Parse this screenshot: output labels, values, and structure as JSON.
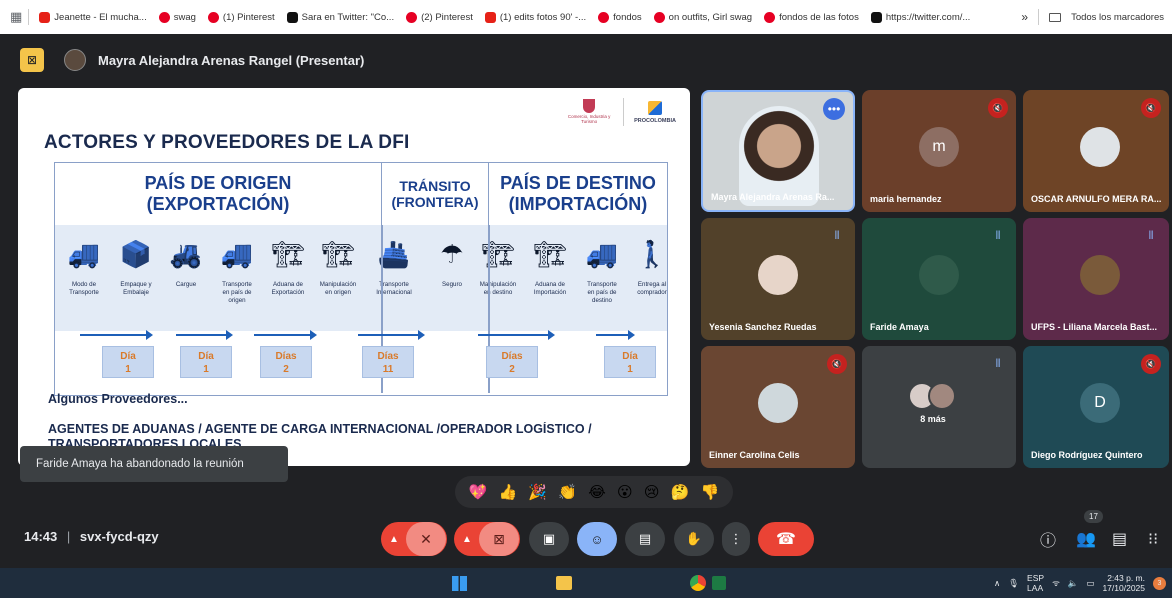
{
  "bookmarks": [
    {
      "label": "Jeanette - El mucha...",
      "icon": "youtube-icon",
      "color": "#e62117"
    },
    {
      "label": "swag",
      "icon": "pinterest-icon",
      "color": "#e60023"
    },
    {
      "label": "(1) Pinterest",
      "icon": "pinterest-icon",
      "color": "#e60023"
    },
    {
      "label": "Sara en Twitter: \"Co...",
      "icon": "x-icon",
      "color": "#111111"
    },
    {
      "label": "(2) Pinterest",
      "icon": "pinterest-icon",
      "color": "#e60023"
    },
    {
      "label": "(1) edits fotos 90' -...",
      "icon": "youtube-icon",
      "color": "#e62117"
    },
    {
      "label": "fondos",
      "icon": "pinterest-icon",
      "color": "#e60023"
    },
    {
      "label": "on outfits, Girl swag",
      "icon": "pinterest-icon",
      "color": "#e60023"
    },
    {
      "label": "fondos de las fotos",
      "icon": "pinterest-icon",
      "color": "#e60023"
    },
    {
      "label": "https://twitter.com/...",
      "icon": "x-icon",
      "color": "#111111"
    }
  ],
  "bookmarks_more": "»",
  "all_bookmarks": "Todos los marcadores",
  "presenter": "Mayra Alejandra Arenas Rangel (Presentar)",
  "slide": {
    "title": "ACTORES Y PROVEEDORES DE LA DFI",
    "logo1": "Comercio, Industria y Turismo",
    "logo2": "PROCOLOMBIA",
    "header_origen": "PAÍS DE ORIGEN\n(EXPORTACIÓN)",
    "header_transito": "TRÁNSITO\n(FRONTERA)",
    "header_destino": "PAÍS DE DESTINO\n(IMPORTACIÓN)",
    "steps": [
      {
        "label": "Modo de\nTransporte",
        "icon": "truck-icon"
      },
      {
        "label": "Empaque y\nEmbalaje",
        "icon": "box-icon"
      },
      {
        "label": "Cargue",
        "icon": "forklift-icon"
      },
      {
        "label": "Transporte\nen país de\norigen",
        "icon": "truck-icon"
      },
      {
        "label": "Aduana de\nExportación",
        "icon": "customs-icon"
      },
      {
        "label": "Manipulación\nen origen",
        "icon": "crane-icon"
      },
      {
        "label": "Transporte\nInternacional",
        "icon": "ship-icon"
      },
      {
        "label": "Seguro",
        "icon": "umbrella-icon"
      },
      {
        "label": "Manipulación\nen destino",
        "icon": "crane-icon"
      },
      {
        "label": "Aduana de\nImportación",
        "icon": "customs-icon"
      },
      {
        "label": "Transporte\nen país de\ndestino",
        "icon": "truck-icon"
      },
      {
        "label": "Entrega al\ncomprador",
        "icon": "person-icon"
      }
    ],
    "days": [
      {
        "label": "Día",
        "num": "1"
      },
      {
        "label": "Día",
        "num": "1"
      },
      {
        "label": "Días",
        "num": "2"
      },
      {
        "label": "Días",
        "num": "11"
      },
      {
        "label": "Días",
        "num": "2"
      },
      {
        "label": "Día",
        "num": "1"
      }
    ],
    "proveedores": "Algunos Proveedores...",
    "agentes": "AGENTES DE ADUANAS / AGENTE DE CARGA INTERNACIONAL /OPERADOR LOGÍSTICO / TRANSPORTADORES LOCALES"
  },
  "toast": "Faride Amaya ha abandonado la reunión",
  "participants": [
    {
      "name": "Mayra Alejandra Arenas Ra...",
      "bg": "#cfd4d6",
      "avatar": "",
      "muted": false
    },
    {
      "name": "maria hernandez",
      "bg": "#6b3f2a",
      "avatar": "m",
      "avatar_bg": "#8d6e63",
      "muted": true
    },
    {
      "name": "OSCAR ARNULFO MERA RA...",
      "bg": "#6e4426",
      "avatar": "",
      "avatar_bg": "#dfe3e6",
      "muted": true
    },
    {
      "name": "Yesenia Sanchez Ruedas",
      "bg": "#52412a",
      "avatar": "",
      "avatar_bg": "#e7d5c9",
      "muted": false
    },
    {
      "name": "Faride Amaya",
      "bg": "#1f4a3c",
      "avatar": "",
      "avatar_bg": "#2f5a4a",
      "muted": false
    },
    {
      "name": "UFPS - Liliana Marcela Bast...",
      "bg": "#5d2a4a",
      "avatar": "",
      "avatar_bg": "#7a5a3a",
      "muted": false
    },
    {
      "name": "Einner Carolina Celis",
      "bg": "#6a4632",
      "avatar": "",
      "avatar_bg": "#cfd8dc",
      "muted": true
    },
    {
      "name": "8 más",
      "bg": "#3c4043",
      "avatar": "",
      "muted": false
    },
    {
      "name": "Diego Rodríguez Quintero",
      "bg": "#1f4a55",
      "avatar": "D",
      "avatar_bg": "#3b6b78",
      "muted": true
    }
  ],
  "reactions": [
    "💖",
    "👍",
    "🎉",
    "👏",
    "😂",
    "😮",
    "😢",
    "🤔",
    "👎"
  ],
  "meeting": {
    "time": "14:43",
    "sep": "|",
    "code": "svx-fycd-qzy"
  },
  "people_count": "17",
  "taskbar": {
    "lang1": "ESP",
    "lang2": "LAA",
    "time": "2:43 p. m.",
    "date": "17/10/2025",
    "badge": "3"
  }
}
